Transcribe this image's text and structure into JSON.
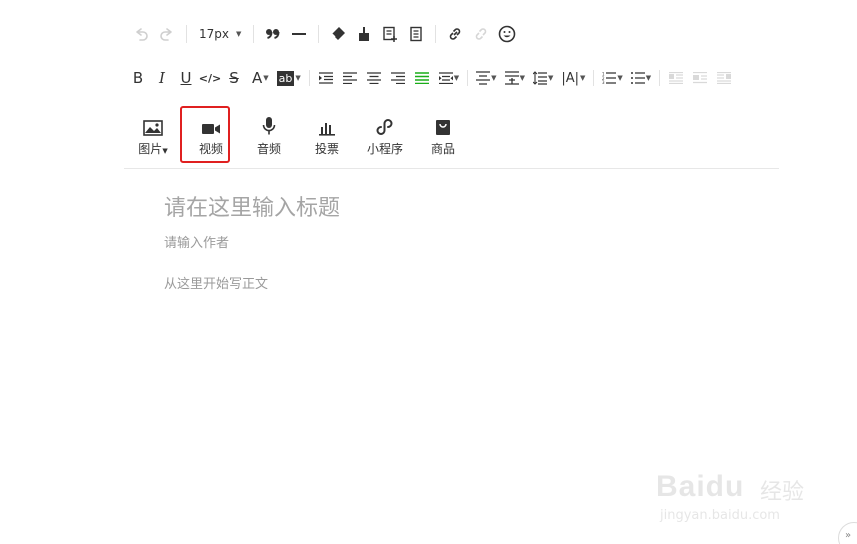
{
  "toolbar": {
    "font_size": "17px",
    "icons_row1": [
      "undo-icon",
      "redo-icon",
      "blockquote-icon",
      "horizontal-rule-icon",
      "eraser-icon",
      "format-painter-icon",
      "template-icon",
      "document-icon",
      "link-icon",
      "unlink-icon",
      "emoji-icon"
    ],
    "format": {
      "bold": "B",
      "italic": "I",
      "underline": "U",
      "code": "</>",
      "strikethrough": "S",
      "font_color": "A",
      "bg_color": "ab",
      "align_label": "|A|"
    }
  },
  "insert": {
    "image": "图片",
    "video": "视频",
    "audio": "音频",
    "vote": "投票",
    "miniprogram": "小程序",
    "product": "商品"
  },
  "editor": {
    "title_placeholder": "请在这里输入标题",
    "author_placeholder": "请输入作者",
    "body_placeholder": "从这里开始写正文"
  },
  "watermark": {
    "brand": "Baidu",
    "cn": "经验",
    "url": "jingyan.baidu.com"
  },
  "colors": {
    "highlight_border": "#e02020",
    "active_align": "#1aad19"
  }
}
